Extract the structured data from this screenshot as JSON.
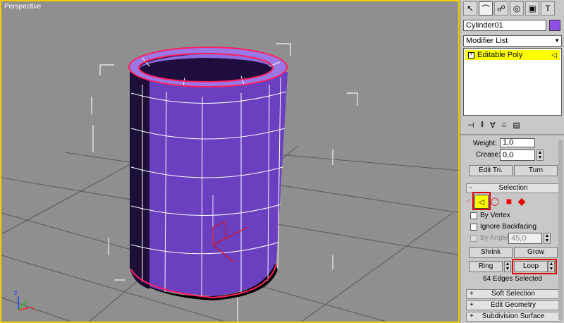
{
  "viewport": {
    "label": "Perspective",
    "axis_labels": {
      "x": "x",
      "y": "y",
      "z": "z"
    }
  },
  "panel": {
    "object_name": "Cylinder01",
    "object_color": "#9050e8",
    "modifier_list": "Modifier List",
    "stack_item": "Editable Poly",
    "weight_label": "Weight:",
    "weight_value": "1,0",
    "crease_label": "Crease:",
    "crease_value": "0,0",
    "edit_tri_label": "Edit Tri.",
    "turn_label": "Turn",
    "selection": {
      "title": "Selection",
      "by_vertex": "By Vertex",
      "ignore_backfacing": "Ignore Backfacing",
      "by_angle": "By Angle:",
      "by_angle_value": "45,0",
      "shrink": "Shrink",
      "grow": "Grow",
      "ring": "Ring",
      "loop": "Loop",
      "status": "64 Edges Selected"
    },
    "rollouts": [
      "Soft Selection",
      "Edit Geometry",
      "Subdivision Surface"
    ]
  },
  "colors": {
    "highlight": "#ffff00",
    "alert_red": "#e00000",
    "cylinder_purple": "#6a3fc0"
  }
}
